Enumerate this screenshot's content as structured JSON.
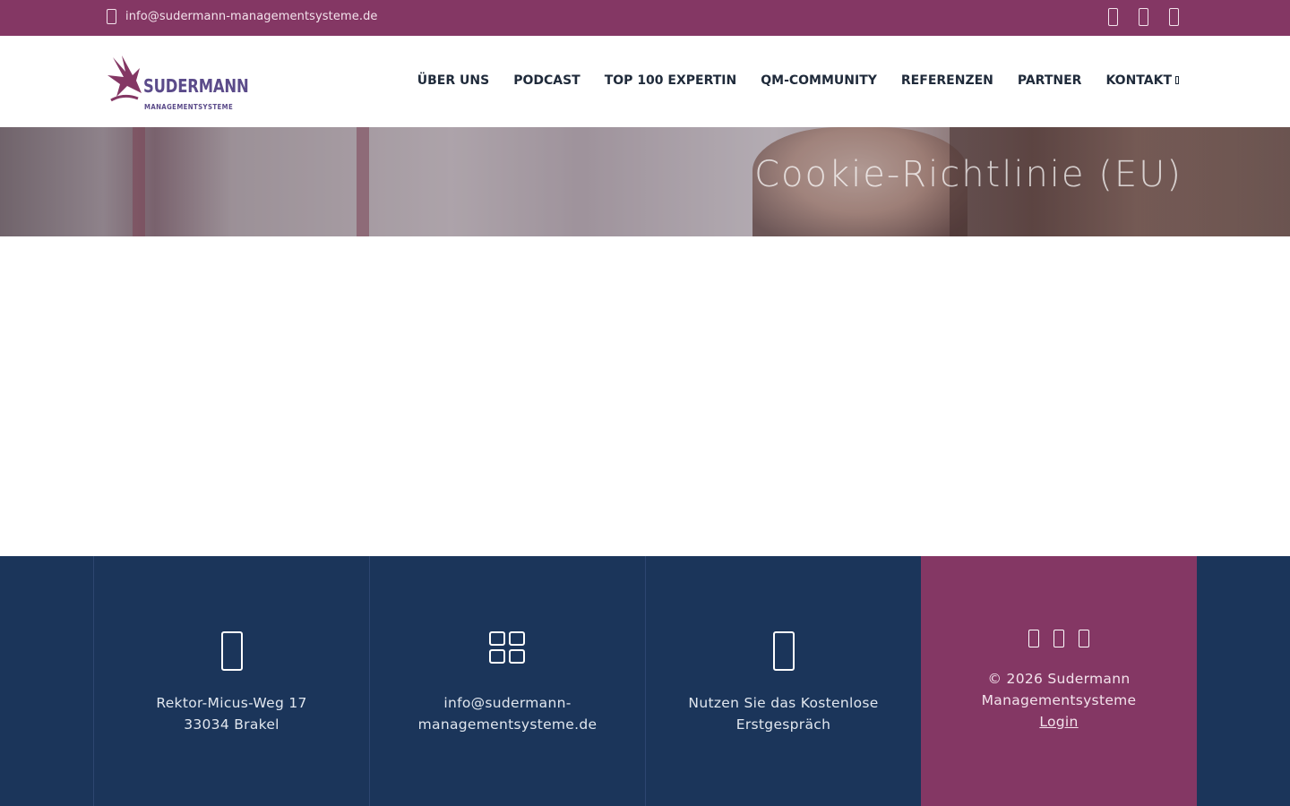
{
  "topbar": {
    "email": "info@sudermann-managementsysteme.de",
    "icons": [
      "mail-icon",
      "facebook-icon",
      "instagram-icon",
      "linkedin-icon"
    ]
  },
  "logo": {
    "name": "SUDERMANN",
    "subtitle": "MANAGEMENTSYSTEME"
  },
  "nav": {
    "items": [
      {
        "label": "ÜBER UNS"
      },
      {
        "label": "PODCAST"
      },
      {
        "label": "TOP 100 EXPERTIN"
      },
      {
        "label": "QM-COMMUNITY"
      },
      {
        "label": "REFERENZEN"
      },
      {
        "label": "PARTNER"
      },
      {
        "label": "KONTAKT"
      }
    ]
  },
  "hero": {
    "title": "Cookie-Richtlinie (EU)"
  },
  "footer": {
    "address": {
      "line1": "Rektor-Micus-Weg 17",
      "line2": "33034 Brakel",
      "icon": "map-marker-icon"
    },
    "email": {
      "line1": "info@sudermann-",
      "line2": "managementsysteme.de",
      "icon": "grid-icon"
    },
    "consult": {
      "line1": "Nutzen Sie das Kostenlose",
      "line2": "Erstgespräch",
      "icon": "phone-icon"
    },
    "copyright": {
      "line1": "© 2026 Sudermann",
      "line2": "Managementsysteme",
      "login": "Login"
    },
    "colors": {
      "footer_bg": "#1b355a",
      "accent": "#843764"
    }
  }
}
